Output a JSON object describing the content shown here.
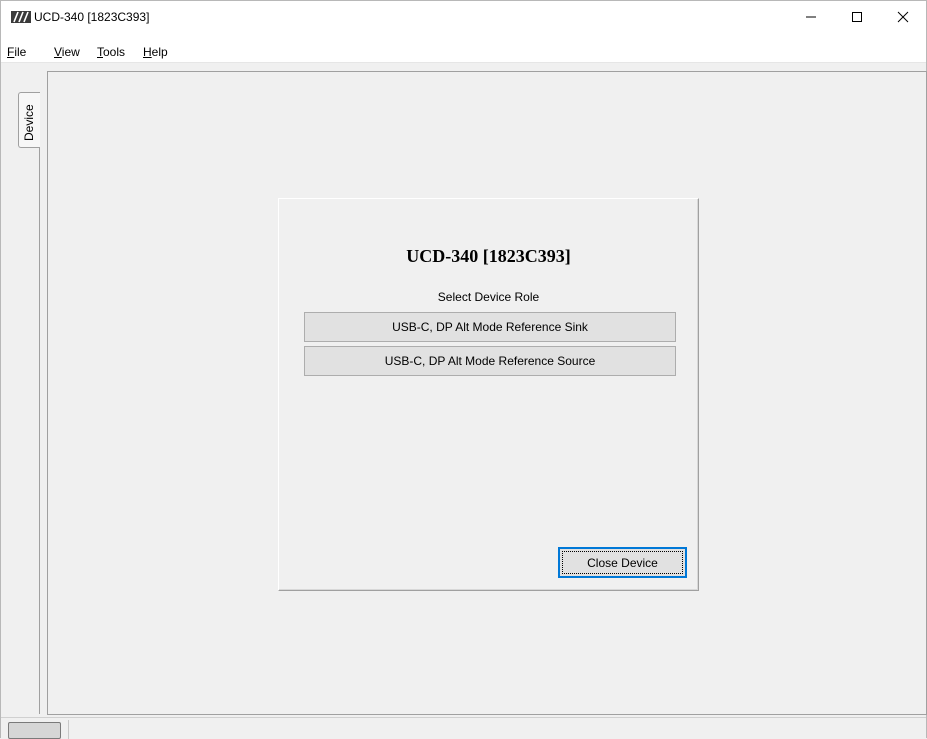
{
  "window": {
    "title": "UCD-340 [1823C393]"
  },
  "menu": {
    "items": [
      {
        "label_underlined": "F",
        "label_rest": "ile"
      },
      {
        "label_underlined": "V",
        "label_rest": "iew"
      },
      {
        "label_underlined": "T",
        "label_rest": "ools"
      },
      {
        "label_underlined": "H",
        "label_rest": "elp"
      }
    ]
  },
  "side_tabs": {
    "device": "Device"
  },
  "panel": {
    "title": "UCD-340 [1823C393]",
    "subtitle": "Select Device Role",
    "roles": [
      "USB-C, DP Alt Mode Reference Sink",
      "USB-C, DP Alt Mode Reference Source"
    ],
    "close_label": "Close Device"
  },
  "colors": {
    "focus_border": "#0078d7",
    "button_face": "#e1e1e1",
    "window_background": "#f0f0f0"
  },
  "icons": {
    "app": "app-logo-icon",
    "minimize": "minimize-icon",
    "maximize": "maximize-icon",
    "close": "close-icon"
  }
}
